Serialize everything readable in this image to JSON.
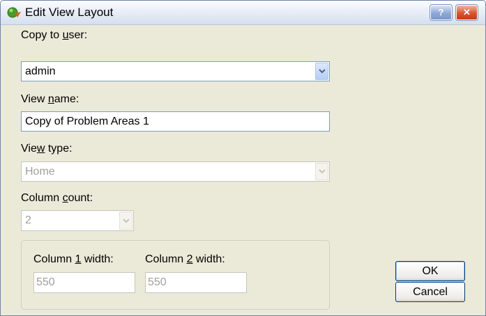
{
  "window": {
    "title": "Edit View Layout",
    "icons": {
      "app": "green-globe-icon",
      "help": "help-icon",
      "close": "close-icon"
    },
    "help_label": "?",
    "close_label": "✕"
  },
  "copy_to_user": {
    "label_pre": "Copy to ",
    "label_ul": "u",
    "label_post": "ser:",
    "value": "admin"
  },
  "view_name": {
    "label_pre": "View ",
    "label_ul": "n",
    "label_post": "ame:",
    "value": "Copy of Problem Areas 1"
  },
  "view_type": {
    "label_pre": "Vie",
    "label_ul": "w",
    "label_post": " type:",
    "value": "Home",
    "enabled": false
  },
  "column_count": {
    "label_pre": "Column ",
    "label_ul": "c",
    "label_post": "ount:",
    "value": "2",
    "enabled": false
  },
  "column_widths": {
    "col1": {
      "label_pre": "Column ",
      "label_ul": "1",
      "label_post": " width:",
      "value": "550"
    },
    "col2": {
      "label_pre": "Column ",
      "label_ul": "2",
      "label_post": " width:",
      "value": "550"
    }
  },
  "buttons": {
    "ok": "OK",
    "cancel": "Cancel"
  },
  "colors": {
    "accent": "#7f9db9",
    "dialog_bg": "#ebe9d8",
    "disabled_text": "#a0a09a"
  }
}
